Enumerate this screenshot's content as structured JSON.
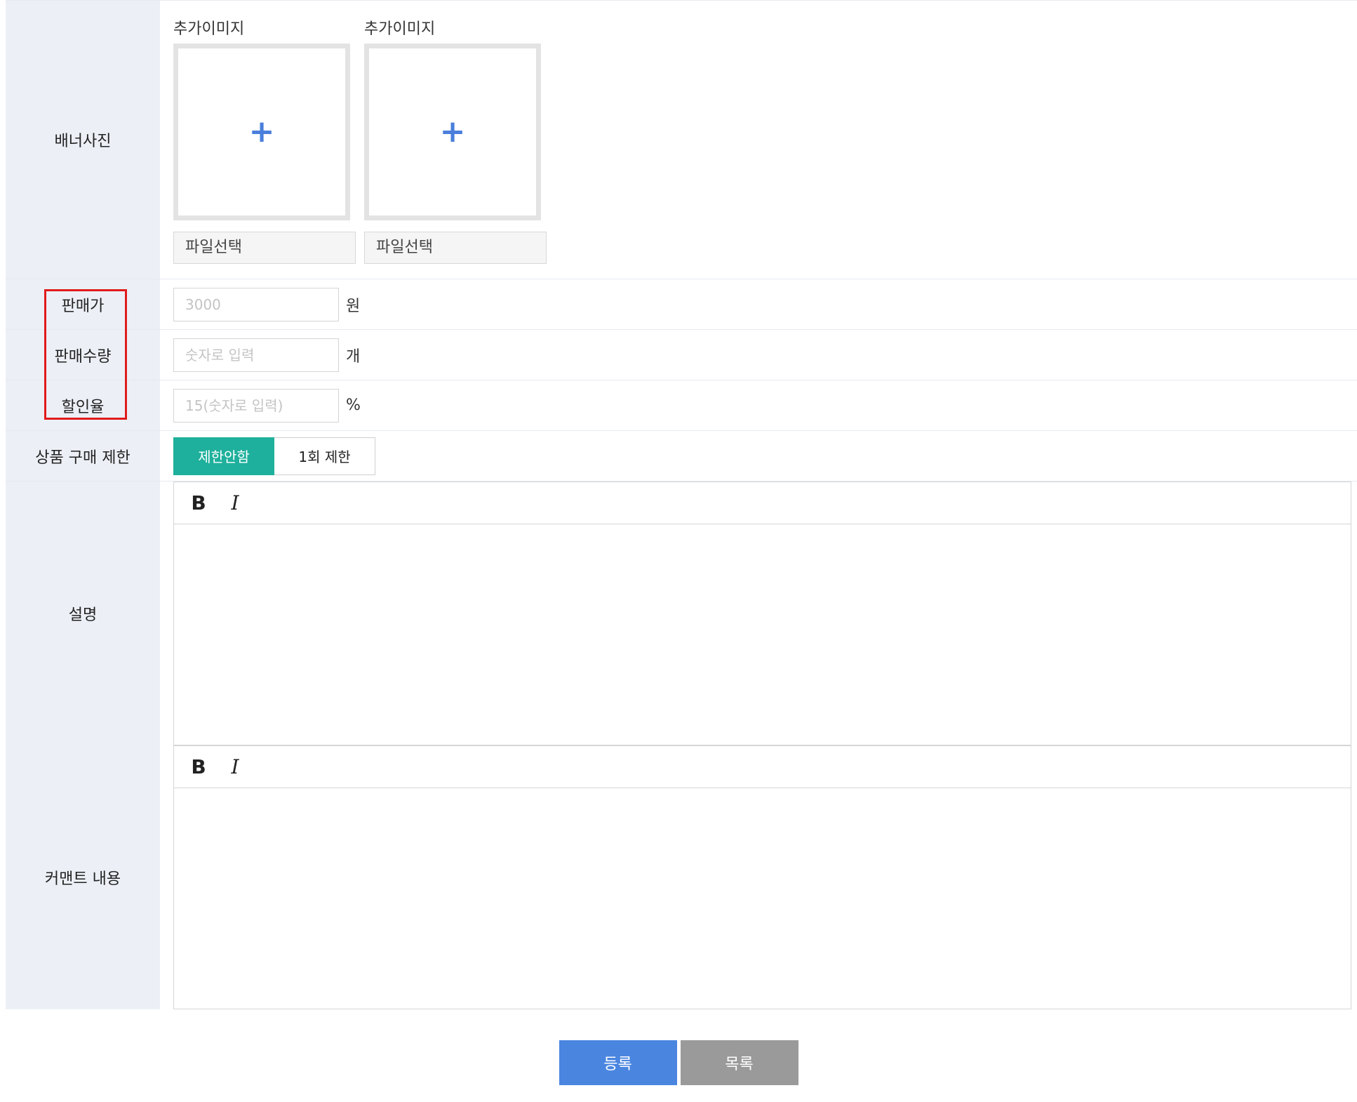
{
  "banner": {
    "label": "배너사진",
    "images": [
      {
        "title": "추가이미지",
        "add_symbol": "+",
        "file_button": "파일선택"
      },
      {
        "title": "추가이미지",
        "add_symbol": "+",
        "file_button": "파일선택"
      }
    ]
  },
  "price": {
    "label": "판매가",
    "placeholder": "3000",
    "value": "",
    "unit": "원"
  },
  "quantity": {
    "label": "판매수량",
    "placeholder": "숫자로 입력",
    "value": "",
    "unit": "개"
  },
  "discount": {
    "label": "할인율",
    "placeholder": "15(숫자로 입력)",
    "value": "",
    "unit": "%"
  },
  "purchase_limit": {
    "label": "상품 구매 제한",
    "options": [
      "제한안함",
      "1회 제한"
    ],
    "selected": "제한안함"
  },
  "description": {
    "label": "설명",
    "toolbar": {
      "bold": "B",
      "italic": "I"
    }
  },
  "comment": {
    "label": "커맨트 내용",
    "toolbar": {
      "bold": "B",
      "italic": "I"
    }
  },
  "actions": {
    "register": "등록",
    "list": "목록"
  },
  "colors": {
    "accent_green": "#1eb09c",
    "primary_blue": "#4a86e0",
    "secondary_gray": "#9a9a9a",
    "label_bg": "#ecf0f6",
    "highlight_red": "#e11b1b",
    "plus_blue": "#4a7fdb"
  },
  "icons": {
    "add_image": "plus-icon",
    "bold": "bold-icon",
    "italic": "italic-icon"
  }
}
